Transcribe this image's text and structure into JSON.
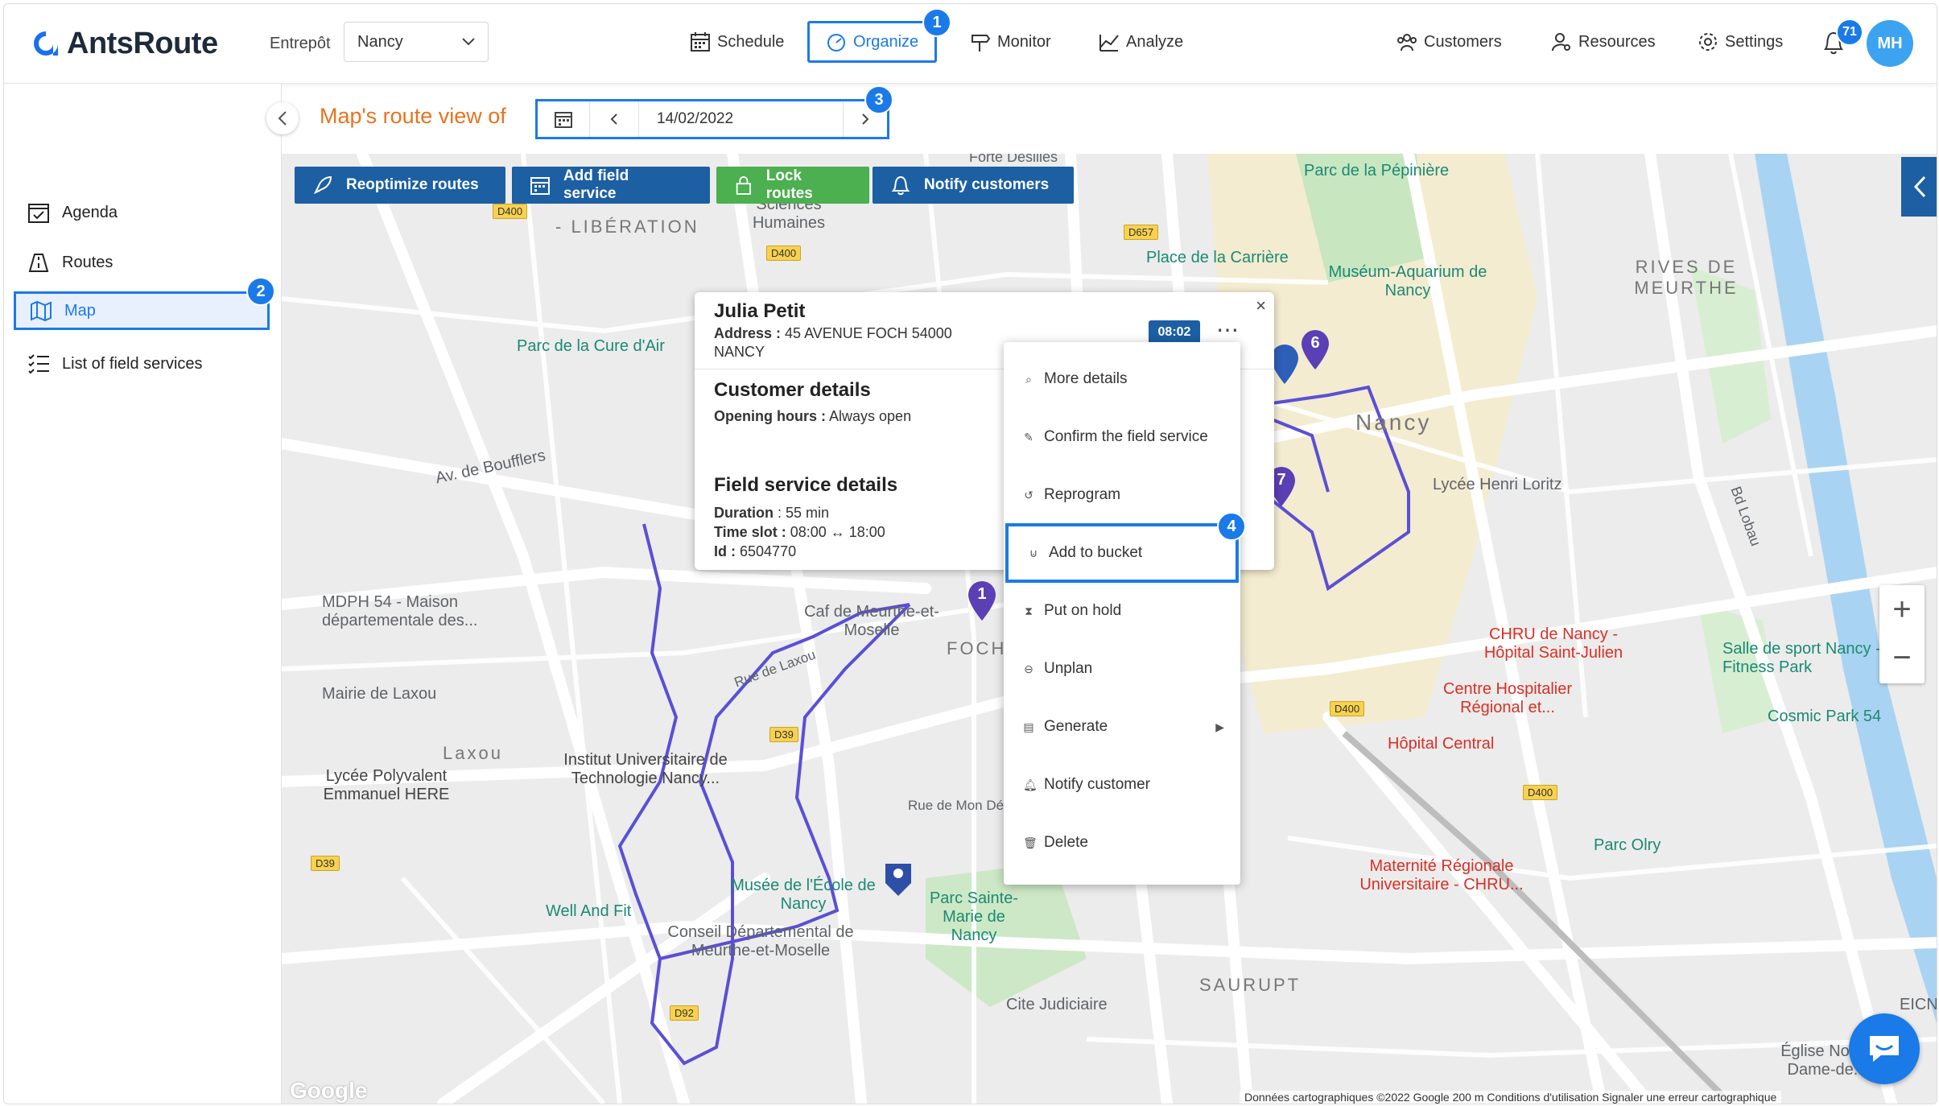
{
  "header": {
    "logo_text": "AntsRoute",
    "warehouse_label": "Entrepôt",
    "warehouse_value": "Nancy",
    "nav": {
      "schedule": "Schedule",
      "organize": "Organize",
      "monitor": "Monitor",
      "analyze": "Analyze",
      "customers": "Customers",
      "resources": "Resources",
      "settings": "Settings"
    },
    "notification_count": "71",
    "avatar_initials": "MH"
  },
  "steps": [
    "1",
    "2",
    "3",
    "4"
  ],
  "sidebar": {
    "items": [
      {
        "label": "Agenda",
        "icon": "calendar-check-icon"
      },
      {
        "label": "Routes",
        "icon": "routes-icon"
      },
      {
        "label": "Map",
        "icon": "map-icon",
        "active": true
      },
      {
        "label": "List of field services",
        "icon": "list-icon"
      }
    ]
  },
  "date_bar": {
    "title": "Map's route view of",
    "date": "14/02/2022"
  },
  "actions": {
    "reoptimize": "Reoptimize routes",
    "add_service": "Add field service",
    "lock": "Lock routes",
    "notify": "Notify customers"
  },
  "popup": {
    "name": "Julia Petit",
    "address_label": "Address :",
    "address_line1": "45 AVENUE FOCH 54000",
    "address_line2": "NANCY",
    "time": "08:02",
    "customer_title": "Customer details",
    "opening_label": "Opening hours :",
    "opening_value": "Always open",
    "service_title": "Field service details",
    "duration_label": "Duration",
    "duration_value": ": 55 min",
    "slot_label": "Time slot :",
    "slot_value": "08:00 ↔ 18:00",
    "id_label": "Id :",
    "id_value": "6504770"
  },
  "menu": {
    "items": [
      {
        "label": "More details",
        "icon": "search-icon"
      },
      {
        "label": "Confirm the field service",
        "icon": "pin-icon"
      },
      {
        "label": "Reprogram",
        "icon": "history-icon"
      },
      {
        "label": "Add to bucket",
        "icon": "bucket-icon"
      },
      {
        "label": "Put on hold",
        "icon": "hourglass-icon"
      },
      {
        "label": "Unplan",
        "icon": "minus-circle-icon"
      },
      {
        "label": "Generate",
        "icon": "document-icon"
      },
      {
        "label": "Notify customer",
        "icon": "bell-icon"
      },
      {
        "label": "Delete",
        "icon": "trash-icon"
      }
    ]
  },
  "map": {
    "markers": [
      "1",
      "6",
      "7"
    ],
    "labels": {
      "parc_pepiniere": "Parc de la Pépinière",
      "place_carriere": "Place de la Carrière",
      "museum": "Muséum-Aquarium de Nancy",
      "rives": "RIVES DE MEURTHE",
      "nancy": "Nancy",
      "lycee_loritz": "Lycée Henri Loritz",
      "parc_cure": "Parc de la Cure d'Air",
      "mdph": "MDPH 54 - Maison départementale des...",
      "cafe_meurthe": "Caf de Meurthe-et-Moselle",
      "mairie_laxou": "Mairie de Laxou",
      "laxou": "Laxou",
      "iut": "Institut Universitaire de Technologie Nancy...",
      "lycee_here": "Lycée Polyvalent Emmanuel HERE",
      "musee_ecole": "Musée de l'École de Nancy",
      "parc_sainte_marie": "Parc Sainte-Marie de Nancy",
      "well_fit": "Well And Fit",
      "conseil": "Conseil Départemental de Meurthe-et-Moselle",
      "cite_judiciaire": "Cite Judiciaire",
      "saurupt": "SAURUPT",
      "chru": "CHRU de Nancy - Hôpital Saint-Julien",
      "salle_sport": "Salle de sport Nancy - Fitness Park",
      "centre_hosp": "Centre Hospitalier Régional et...",
      "hopital_central": "Hôpital Central",
      "cosmic": "Cosmic Park 54",
      "parc_olry": "Parc Olry",
      "maternite": "Maternité Régionale Universitaire - CHRU...",
      "eglise": "Église Notre-Dame-de...",
      "sciences": "Sciences Humaines",
      "liberation": "- LIBÉRATION",
      "foch": "FOCH",
      "rue_mon_desert": "Rue de Mon Désert",
      "av_boufflers": "Av. de Boufflers",
      "rue_laxou": "Rue de Laxou",
      "bd_lobau": "Bd Lobau",
      "eicn": "EICN",
      "fort_desilles": "Forte Desilles"
    },
    "roads": [
      "D400",
      "D657",
      "D39",
      "D92",
      "D39",
      "D400",
      "D400",
      "D400"
    ],
    "attribution": "Données cartographiques ©2022 Google    200 m            Conditions d'utilisation    Signaler une erreur cartographique",
    "google": "Google",
    "route_color": "#5b4fd6",
    "marker_color": "#5b3fb4"
  },
  "colors": {
    "accent": "#1a7ae8",
    "action_blue": "#1c5fa3",
    "action_green": "#4caf50",
    "title_orange": "#e8731e"
  }
}
